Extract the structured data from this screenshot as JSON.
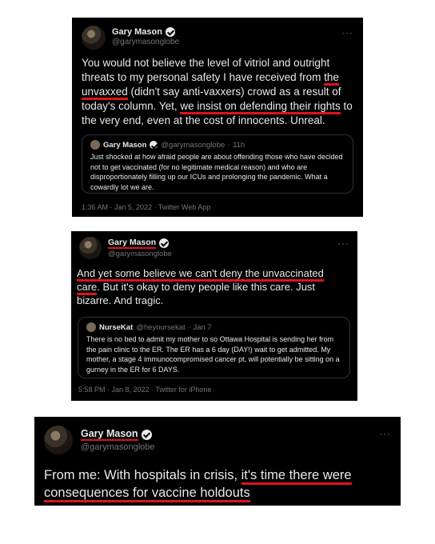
{
  "tweet1": {
    "name": "Gary Mason",
    "handle": "@garymasonglobe",
    "more": "···",
    "text": {
      "a": "You would not believe the level of vitriol and outright threats to my personal safety I have received from ",
      "u1": "the unvaxxed",
      "b": " (didn't say anti-vaxxers) crowd as a result of today's column. Yet, ",
      "u2": "we insist on defending their rights",
      "c": " to the very end, even at the cost of innocents. Unreal."
    },
    "quote": {
      "name": "Gary Mason",
      "handle": "@garymasonglobe",
      "time": "· 11h",
      "text": "Just shocked at how afraid people are about offending those who have decided not to get vaccinated (for no legitimate medical reason) and who are disproportionately filling up our ICUs and prolonging the pandemic. What a cowardly lot we are."
    },
    "meta": {
      "time": "1:36 AM · Jan 5, 2022",
      "source": "· Twitter Web App"
    }
  },
  "tweet2": {
    "name": "Gary Mason",
    "handle": "@garymasonglobe",
    "more": "···",
    "text": {
      "u1": "And yet some believe we can't deny the unvaccinated care",
      "b": ". But it's okay to deny people like this care. Just bizarre. And tragic."
    },
    "quote": {
      "name": "NurseKat",
      "handle": "@heynursekat",
      "time": "· Jan 7",
      "text": "There is no bed to admit my mother to so Ottawa Hospital is sending her from the pain clinic to the ER. The ER has a 6 day (DAY!) wait to get admitted. My mother, a stage 4 immunocompromised cancer pt, will potentially be sitting on a gurney in the ER for 6 DAYS."
    },
    "meta": {
      "time": "5:58 PM · Jan 8, 2022",
      "source": "· Twitter for iPhone"
    }
  },
  "tweet3": {
    "name": "Gary Mason",
    "handle": "@garymasonglobe",
    "more": "···",
    "text": {
      "a": "From me: With hospitals in crisis, ",
      "u1": "it's time there were consequences for vaccine holdouts"
    }
  },
  "colors": {
    "underline": "#e0121e",
    "card": "#000000",
    "text": "#e7e9ea",
    "muted": "#71767b"
  }
}
